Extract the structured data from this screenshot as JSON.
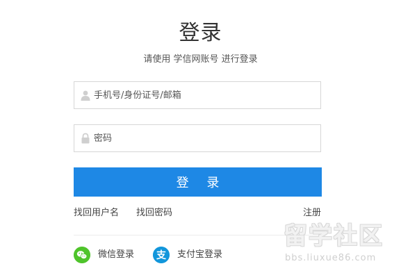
{
  "header": {
    "title": "登录",
    "subtitle": "请使用 学信网账号 进行登录"
  },
  "form": {
    "username_placeholder": "手机号/身份证号/邮箱",
    "password_placeholder": "密码",
    "submit_label": "登 录"
  },
  "links": {
    "find_username": "找回用户名",
    "find_password": "找回密码",
    "register": "注册"
  },
  "social": {
    "wechat_label": "微信登录",
    "alipay_label": "支付宝登录",
    "wechat_icon": "wechat-icon",
    "alipay_icon": "alipay-icon",
    "wechat_color": "#4fc42b",
    "alipay_color": "#1296db"
  },
  "theme": {
    "accent": "#1e88e5"
  },
  "watermark": {
    "text": "留学社区",
    "url": "bbs.liuxue86.com"
  }
}
